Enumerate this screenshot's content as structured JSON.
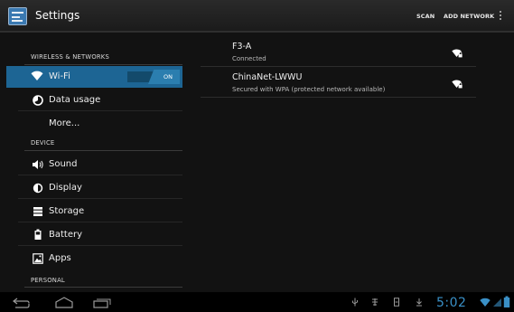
{
  "action_bar": {
    "title": "Settings",
    "scan_label": "SCAN",
    "add_network_label": "ADD NETWORK",
    "app_icon": "settings-icon",
    "overflow_icon": "overflow-menu-icon"
  },
  "sidebar": {
    "sections": [
      {
        "header": "WIRELESS & NETWORKS"
      },
      {
        "header": "DEVICE"
      },
      {
        "header": "PERSONAL"
      }
    ],
    "items": [
      {
        "label": "Wi-Fi",
        "icon": "wifi-icon",
        "selected": true
      },
      {
        "label": "Data usage",
        "icon": "data-usage-icon"
      },
      {
        "label": "More...",
        "icon": ""
      },
      {
        "label": "Sound",
        "icon": "speaker-icon"
      },
      {
        "label": "Display",
        "icon": "brightness-icon"
      },
      {
        "label": "Storage",
        "icon": "storage-icon"
      },
      {
        "label": "Battery",
        "icon": "battery-icon"
      },
      {
        "label": "Apps",
        "icon": "apps-icon"
      }
    ],
    "wifi_toggle": {
      "label": "ON",
      "state": true
    }
  },
  "networks": [
    {
      "name": "F3-A",
      "status": "Connected",
      "icon": "wifi-signal-locked-icon"
    },
    {
      "name": "ChinaNet-LWWU",
      "status": "Secured with WPA (protected network available)",
      "icon": "wifi-signal-locked-icon"
    }
  ],
  "nav_bar": {
    "back_icon": "back-icon",
    "home_icon": "home-icon",
    "recent_icon": "recent-apps-icon",
    "clock": "5:02",
    "notification_icons": [
      "usb-icon",
      "usb-debug-icon",
      "sd-card-icon",
      "download-icon"
    ],
    "status_icons": [
      "wifi-icon",
      "cell-signal-icon",
      "battery-icon"
    ]
  },
  "colors": {
    "accent": "#1d6594",
    "clock": "#3a90c7",
    "background": "#121212"
  }
}
